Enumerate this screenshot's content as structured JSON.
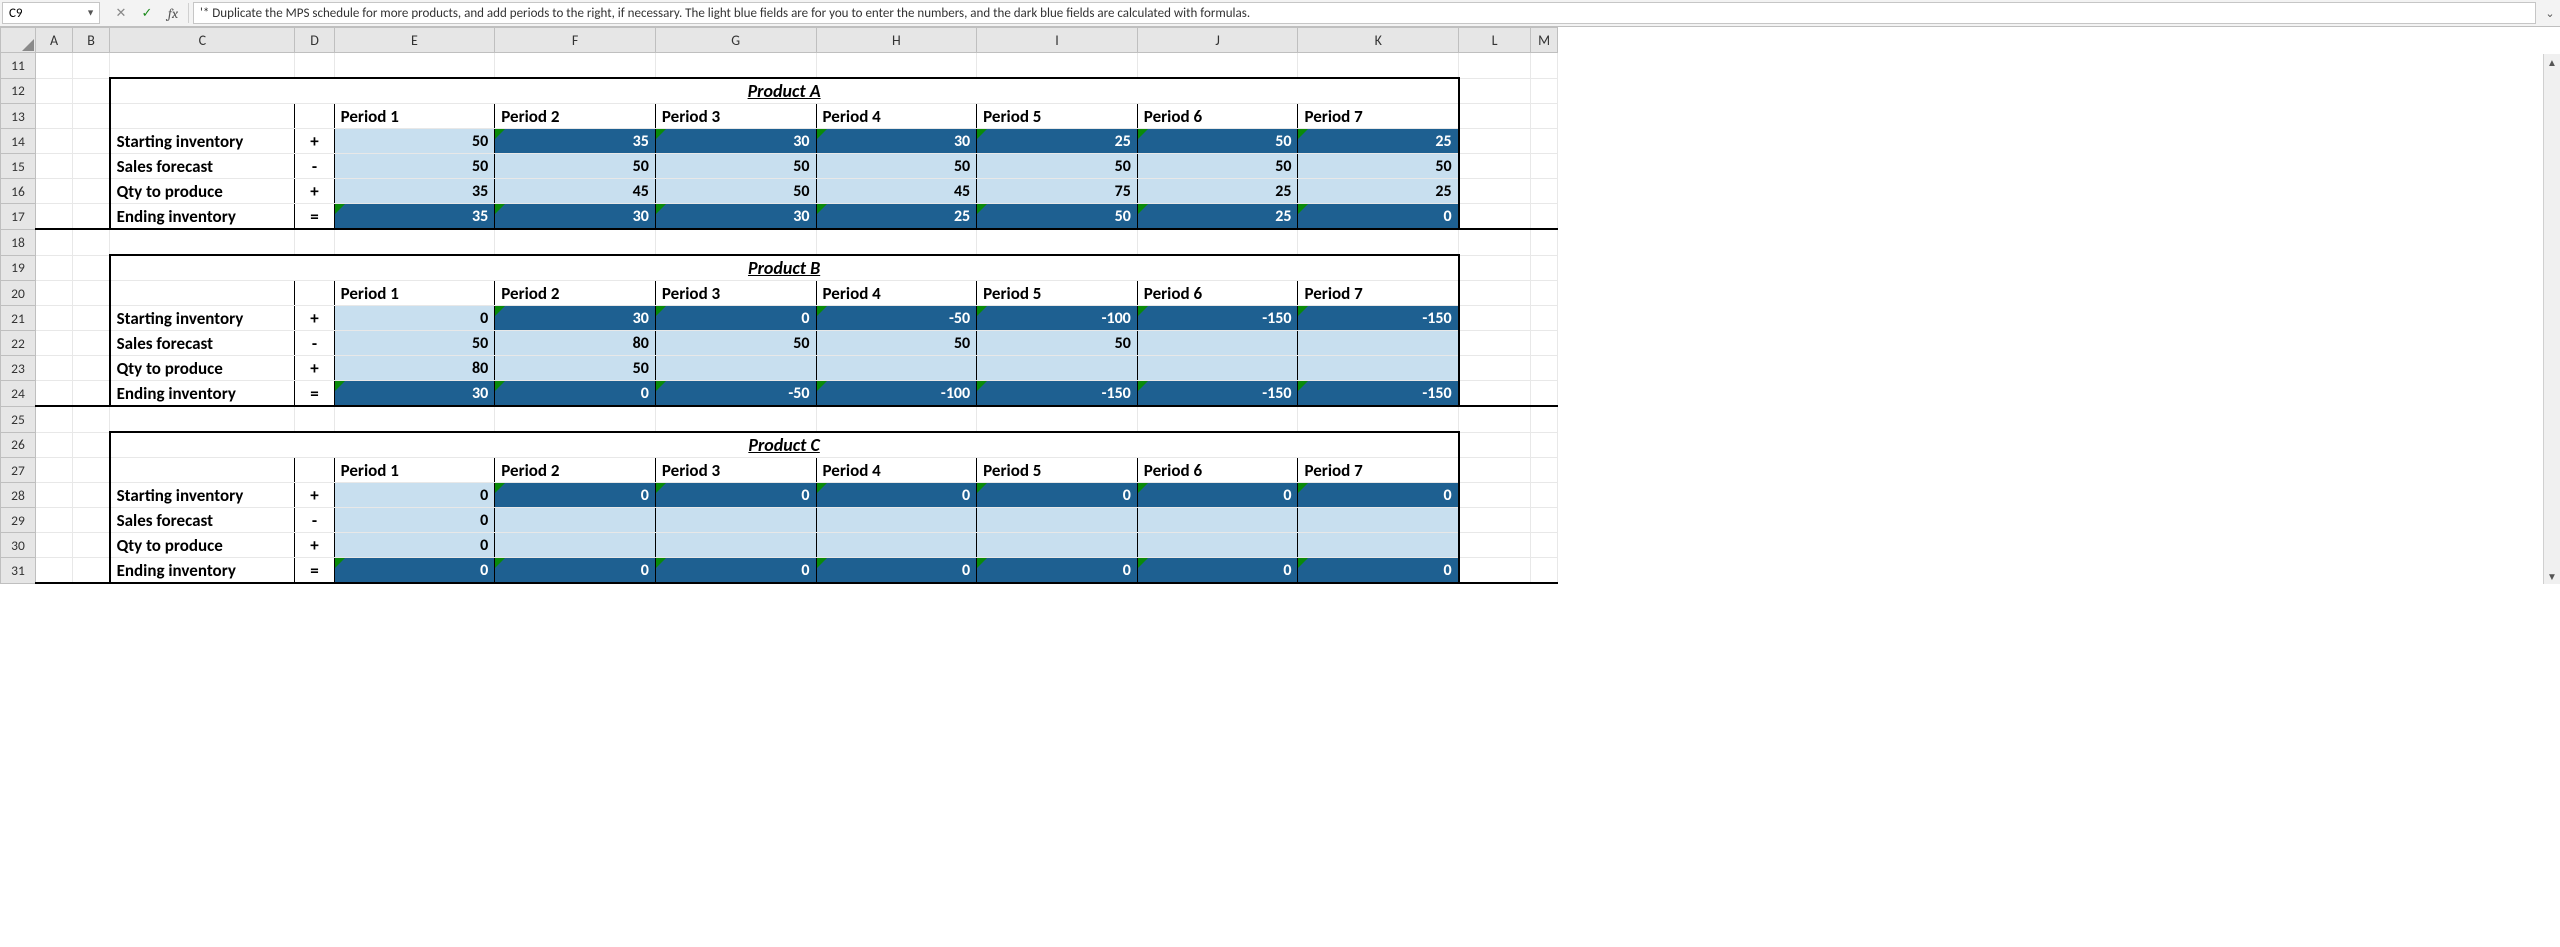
{
  "formula_bar": {
    "cell_ref": "C9",
    "cancel_glyph": "✕",
    "enter_glyph": "✓",
    "fx_label": "fx",
    "formula_text": "'* Duplicate the MPS schedule for more products, and add periods to the right, if necessary. The light blue fields are for you to enter the numbers, and the dark blue fields are calculated with formulas."
  },
  "columns": [
    "A",
    "B",
    "C",
    "D",
    "E",
    "F",
    "G",
    "H",
    "I",
    "J",
    "K",
    "L",
    "M"
  ],
  "row_headers": [
    "11",
    "12",
    "13",
    "14",
    "15",
    "16",
    "17",
    "18",
    "19",
    "20",
    "21",
    "22",
    "23",
    "24",
    "25",
    "26",
    "27",
    "28",
    "29",
    "30",
    "31"
  ],
  "period_labels": [
    "Period 1",
    "Period 2",
    "Period 3",
    "Period 4",
    "Period 5",
    "Period 6",
    "Period 7"
  ],
  "row_meta": {
    "start": {
      "label": "Starting inventory",
      "sign": "+"
    },
    "sales": {
      "label": "Sales forecast",
      "sign": "-"
    },
    "qty": {
      "label": "Qty to produce",
      "sign": "+"
    },
    "end": {
      "label": "Ending inventory",
      "sign": "="
    }
  },
  "products": [
    {
      "title": "Product A",
      "start": [
        "50",
        "35",
        "30",
        "30",
        "25",
        "50",
        "25"
      ],
      "sales": [
        "50",
        "50",
        "50",
        "50",
        "50",
        "50",
        "50"
      ],
      "qty": [
        "35",
        "45",
        "50",
        "45",
        "75",
        "25",
        "25"
      ],
      "end": [
        "35",
        "30",
        "30",
        "25",
        "50",
        "25",
        "0"
      ]
    },
    {
      "title": "Product B",
      "start": [
        "0",
        "30",
        "0",
        "-50",
        "-100",
        "-150",
        "-150"
      ],
      "sales": [
        "50",
        "80",
        "50",
        "50",
        "50",
        "",
        ""
      ],
      "qty": [
        "80",
        "50",
        "",
        "",
        "",
        "",
        ""
      ],
      "end": [
        "30",
        "0",
        "-50",
        "-100",
        "-150",
        "-150",
        "-150"
      ]
    },
    {
      "title": "Product C",
      "start": [
        "0",
        "0",
        "0",
        "0",
        "0",
        "0",
        "0"
      ],
      "sales": [
        "0",
        "",
        "",
        "",
        "",
        "",
        ""
      ],
      "qty": [
        "0",
        "",
        "",
        "",
        "",
        "",
        ""
      ],
      "end": [
        "0",
        "0",
        "0",
        "0",
        "0",
        "0",
        "0"
      ]
    }
  ]
}
